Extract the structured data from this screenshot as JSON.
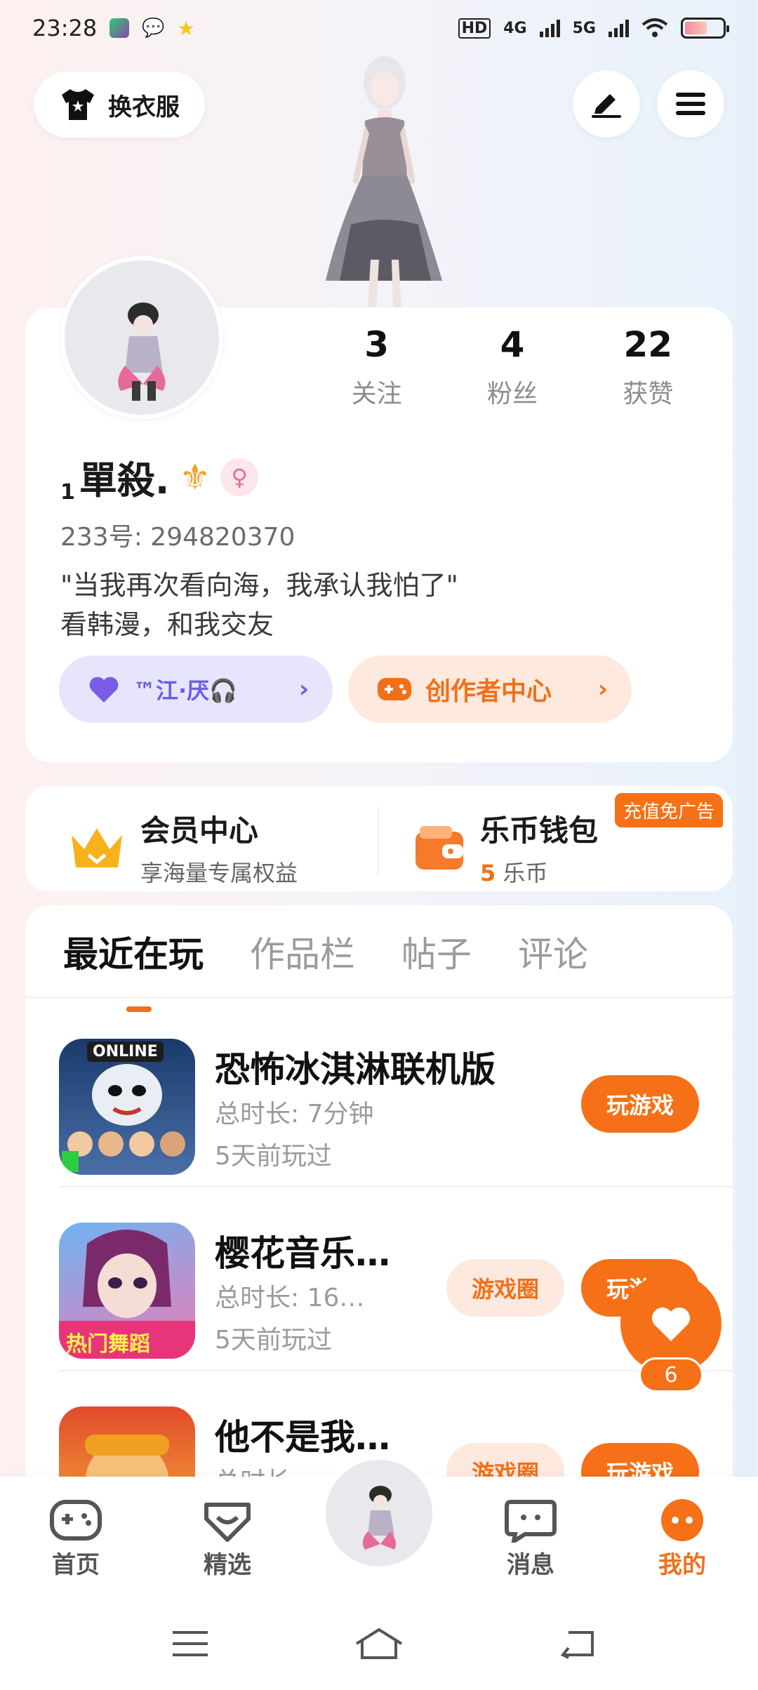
{
  "status_bar": {
    "time": "23:28",
    "network_4g": "4G",
    "network_5g": "5G",
    "hd": "HD"
  },
  "header": {
    "change_clothes_label": "换衣服"
  },
  "profile": {
    "stats": [
      {
        "value": "3",
        "label": "关注"
      },
      {
        "value": "4",
        "label": "粉丝"
      },
      {
        "value": "22",
        "label": "获赞"
      }
    ],
    "username_prefix": "1",
    "username": "單殺.",
    "uid": "233号: 294820370",
    "bio_line1": "\"当我再次看向海，我承认我怕了\"",
    "bio_line2": "看韩漫，和我交友",
    "music_pill": "™江·厌🎧",
    "creator_pill": "创作者中心"
  },
  "vip": {
    "member_title": "会员中心",
    "member_sub": "享海量专属权益",
    "wallet_title": "乐币钱包",
    "wallet_coins": "5",
    "wallet_unit": "乐币",
    "ad_tag": "充值免广告"
  },
  "tabs": [
    "最近在玩",
    "作品栏",
    "帖子",
    "评论"
  ],
  "games": [
    {
      "name": "恐怖冰淇淋联机版",
      "duration": "总时长: 7分钟",
      "last_played": "5天前玩过",
      "play_label": "玩游戏",
      "icon_text": "ONLINE"
    },
    {
      "name": "樱花音乐…",
      "duration": "总时长: 16…",
      "last_played": "5天前玩过",
      "circle_label": "游戏圈",
      "play_label": "玩游戏",
      "icon_text": "热门舞蹈"
    },
    {
      "name": "他不是我…",
      "duration": "总时长: …",
      "last_played": "",
      "circle_label": "游戏圈",
      "play_label": "玩游戏"
    }
  ],
  "float_like": {
    "count": "6"
  },
  "bottom_nav": [
    {
      "label": "首页"
    },
    {
      "label": "精选"
    },
    {
      "label": "消息"
    },
    {
      "label": "我的"
    }
  ],
  "colors": {
    "accent": "#f57016",
    "music_pill": "#6c5ce7"
  }
}
